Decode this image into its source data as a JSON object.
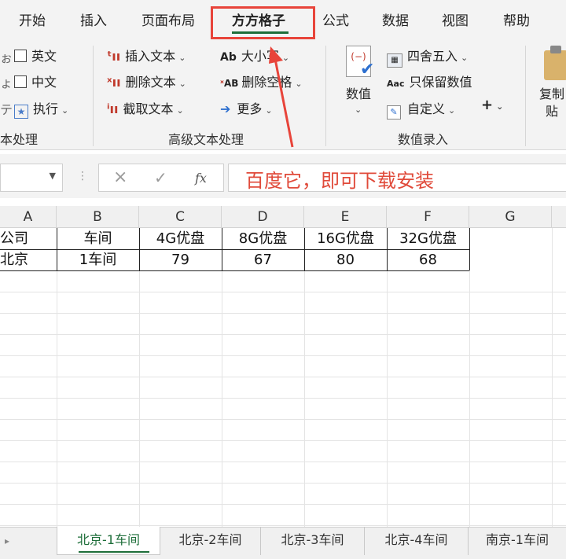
{
  "ribbon_tabs": [
    {
      "label": "开始"
    },
    {
      "label": "插入"
    },
    {
      "label": "页面布局"
    },
    {
      "label": "方方格子"
    },
    {
      "label": "公式"
    },
    {
      "label": "数据"
    },
    {
      "label": "视图"
    },
    {
      "label": "帮助"
    }
  ],
  "ribbon": {
    "text_group": {
      "english": "英文",
      "chinese": "中文",
      "execute": "执行",
      "label": "本处理"
    },
    "advanced_group": {
      "insert_text": "插入文本",
      "delete_text": "删除文本",
      "extract_text": "截取文本",
      "case": "大小写",
      "delete_space": "删除空格",
      "more": "更多",
      "label": "高级文本处理",
      "ab_prefix": "Ab",
      "ab2_prefix": "AB"
    },
    "number_group": {
      "number": "数值",
      "round": "四舍五入",
      "keep_number": "只保留数值",
      "custom": "自定义",
      "plus": "+",
      "label": "数值录入",
      "a_prefix": "Aa"
    },
    "copy_paste": {
      "label_line1": "复制",
      "label_line2": "贴"
    }
  },
  "formula_bar": {
    "cancel": "×",
    "confirm": "✓",
    "fx": "fx"
  },
  "annotation": {
    "text": "百度它，即可下载安装"
  },
  "columns": [
    "A",
    "B",
    "C",
    "D",
    "E",
    "F",
    "G"
  ],
  "table": {
    "header": [
      "公司",
      "车间",
      "4G优盘",
      "8G优盘",
      "16G优盘",
      "32G优盘"
    ],
    "rows": [
      [
        "北京",
        "1车间",
        "79",
        "67",
        "80",
        "68"
      ]
    ]
  },
  "sheets": [
    {
      "label": "北京-1车间"
    },
    {
      "label": "北京-2车间"
    },
    {
      "label": "北京-3车间"
    },
    {
      "label": "北京-4车间"
    },
    {
      "label": "南京-1车间"
    }
  ],
  "colors": {
    "accent": "#1e6e3a",
    "annotation": "#e8443a"
  }
}
